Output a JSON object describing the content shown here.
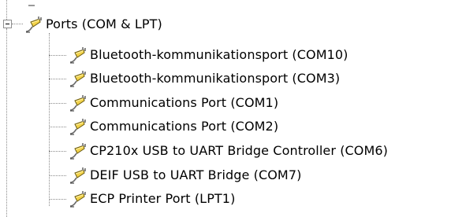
{
  "device_tree": {
    "category": {
      "label": "Ports (COM & LPT)",
      "expanded": true,
      "icon": "port-connector-icon"
    },
    "items": [
      {
        "label": "Bluetooth-kommunikationsport (COM10)",
        "icon": "port-connector-icon"
      },
      {
        "label": "Bluetooth-kommunikationsport (COM3)",
        "icon": "port-connector-icon"
      },
      {
        "label": "Communications Port (COM1)",
        "icon": "port-connector-icon"
      },
      {
        "label": "Communications Port (COM2)",
        "icon": "port-connector-icon"
      },
      {
        "label": "CP210x USB to UART Bridge Controller (COM6)",
        "icon": "port-connector-icon"
      },
      {
        "label": "DEIF USB to UART Bridge (COM7)",
        "icon": "port-connector-icon"
      },
      {
        "label": "ECP Printer Port (LPT1)",
        "icon": "port-connector-icon"
      }
    ]
  }
}
